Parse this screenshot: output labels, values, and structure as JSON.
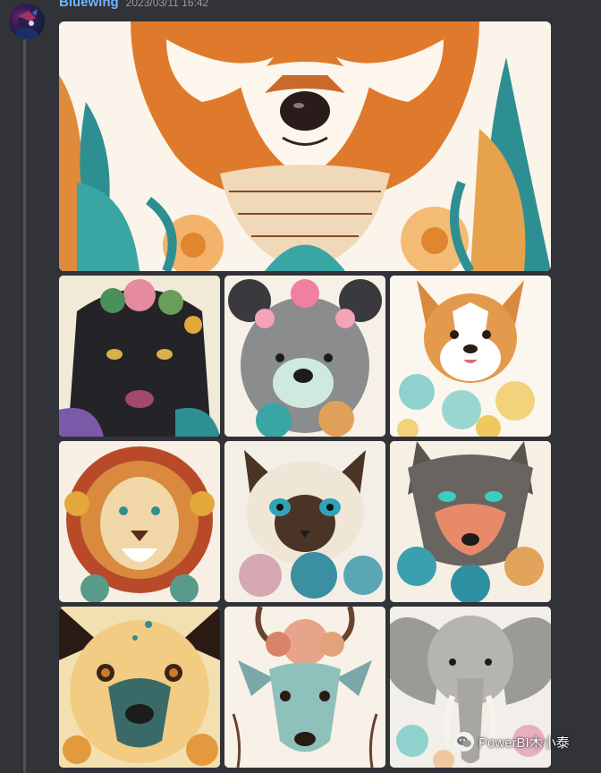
{
  "message": {
    "username": "Bluewing",
    "timestamp": "2023/03/11 16:42"
  },
  "watermark": {
    "text": "PowerBI木小泰",
    "icon": "wechat-icon"
  },
  "images": {
    "hero": "red-fox-illustration",
    "tiles": [
      "black-panther-illustration",
      "floral-bear-illustration",
      "corgi-dog-illustration",
      "lion-illustration",
      "siamese-cat-illustration",
      "wolf-illustration",
      "hyena-illustration",
      "deer-illustration",
      "elephant-illustration"
    ]
  },
  "colors": {
    "username": "#6eb4ff",
    "background": "#313338"
  }
}
